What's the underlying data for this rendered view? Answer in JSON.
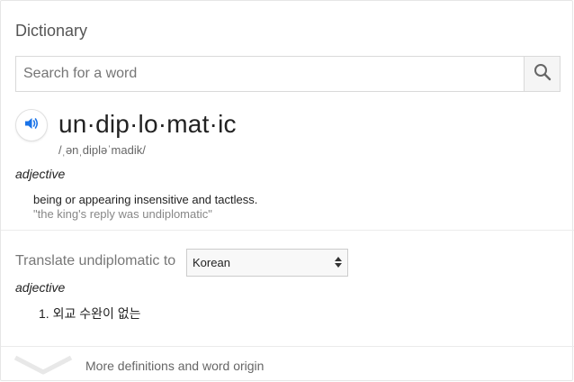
{
  "dictionary": {
    "title": "Dictionary",
    "search": {
      "placeholder": "Search for a word",
      "value": ""
    },
    "entry": {
      "headword": "un·dip·lo·mat·ic",
      "phonetic": "/ˌənˌdipləˈmadik/",
      "part_of_speech": "adjective",
      "definition": "being or appearing insensitive and tactless.",
      "example": "\"the king's reply was undiplomatic\""
    },
    "translate": {
      "label": "Translate undiplomatic to",
      "language": "Korean",
      "part_of_speech": "adjective",
      "items": [
        "1. 외교 수완이 없는"
      ]
    },
    "footer": {
      "more_label": "More definitions and word origin"
    },
    "colors": {
      "accent": "#1a73e8",
      "muted": "#777777",
      "example": "#878787"
    }
  }
}
